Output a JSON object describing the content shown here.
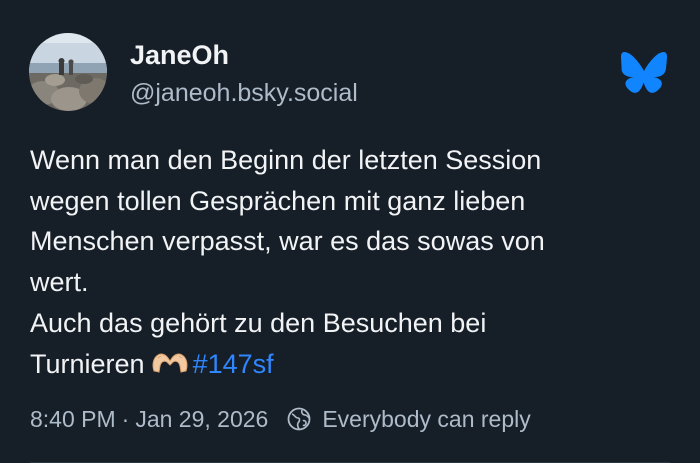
{
  "author": {
    "display_name": "JaneOh",
    "handle": "@janeoh.bsky.social",
    "avatar_icon": "profile-photo-rocks-by-sea"
  },
  "platform": {
    "logo_icon": "bluesky-butterfly-icon",
    "brand_color": "#1185fe"
  },
  "post": {
    "lines": [
      "Wenn man den Beginn der letzten Session",
      "wegen tollen Gesprächen mit ganz lieben",
      "Menschen verpasst, war es das sowas von",
      "wert.",
      "Auch das gehört zu den Besuchen bei",
      "Turnieren"
    ],
    "emoji_icon": "heart-hands-emoji",
    "hashtag": "#147sf",
    "hashtag_color": "#2f87ff"
  },
  "meta": {
    "time": "8:40 PM",
    "separator": "·",
    "date": "Jan 29, 2026",
    "reply_setting_icon": "globe-icon",
    "reply_setting": "Everybody can reply"
  },
  "colors": {
    "background": "#161e27",
    "text": "#f1f3f5",
    "muted": "#aebbc9"
  }
}
